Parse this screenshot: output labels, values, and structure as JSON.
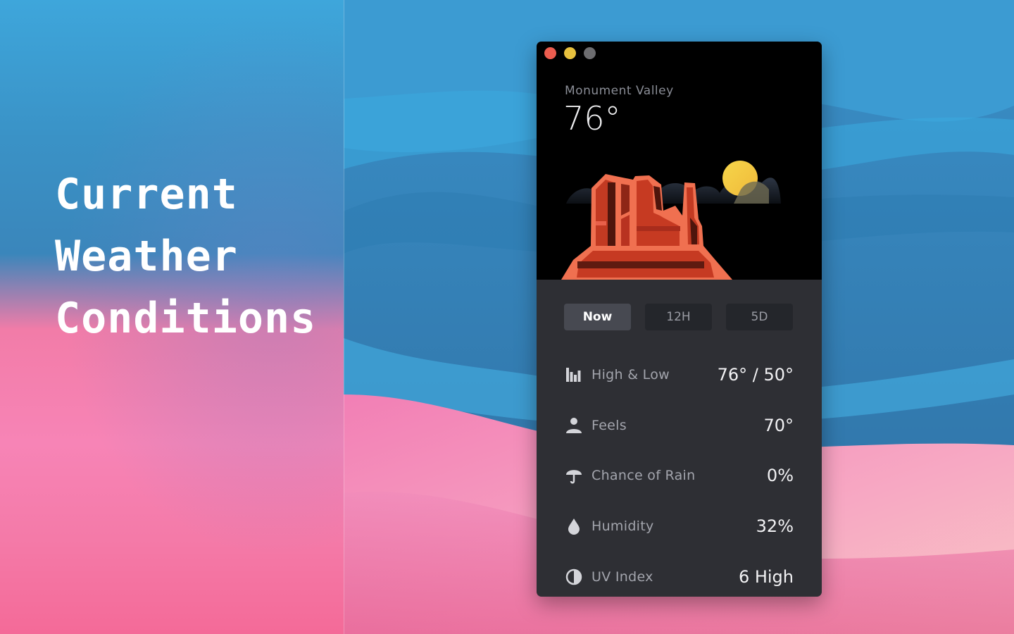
{
  "headline": [
    "Current",
    "Weather",
    "Conditions"
  ],
  "window": {
    "controls": {
      "close_color": "#ec5d4f",
      "minimize_color": "#e8c13e",
      "zoom_color": "#6d6d70"
    },
    "location": "Monument Valley",
    "temperature": "76°",
    "tabs": [
      {
        "label": "Now",
        "active": true
      },
      {
        "label": "12H",
        "active": false
      },
      {
        "label": "5D",
        "active": false
      }
    ],
    "rows": [
      {
        "icon": "bar-chart-icon",
        "label": "High & Low",
        "value": "76° / 50°"
      },
      {
        "icon": "person-icon",
        "label": "Feels",
        "value": "70°"
      },
      {
        "icon": "umbrella-icon",
        "label": "Chance of Rain",
        "value": "0%"
      },
      {
        "icon": "droplet-icon",
        "label": "Humidity",
        "value": "32%"
      },
      {
        "icon": "half-circle-icon",
        "label": "UV Index",
        "value": "6 High"
      }
    ]
  }
}
